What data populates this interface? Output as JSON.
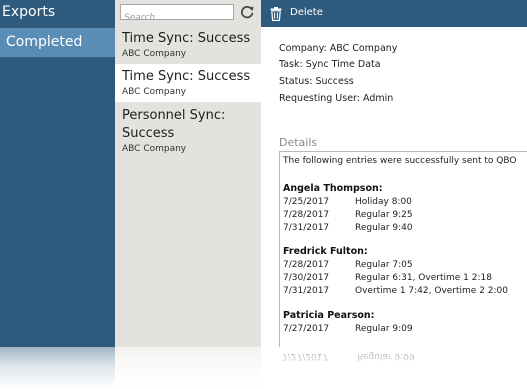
{
  "nav": {
    "title": "Exports",
    "items": [
      {
        "label": "Completed"
      }
    ]
  },
  "list": {
    "search_placeholder": "Search ...",
    "items": [
      {
        "title": "Time Sync: Success",
        "subtitle": "ABC Company"
      },
      {
        "title": "Time Sync: Success",
        "subtitle": "ABC Company"
      },
      {
        "title": "Personnel Sync: Success",
        "subtitle": "ABC Company"
      }
    ]
  },
  "toolbar": {
    "delete_label": "Delete"
  },
  "detail": {
    "company": "Company: ABC Company",
    "task": "Task: Sync Time Data",
    "status": "Status: Success",
    "user": "Requesting User: Admin",
    "details_label": "Details",
    "intro": "The following entries were successfully sent to QBO",
    "employees": [
      {
        "name": "Angela Thompson:",
        "entries": [
          {
            "date": "7/25/2017",
            "desc": "Holiday 8:00"
          },
          {
            "date": "7/28/2017",
            "desc": "Regular 9:25"
          },
          {
            "date": "7/31/2017",
            "desc": "Regular 9:40"
          }
        ]
      },
      {
        "name": "Fredrick Fulton:",
        "entries": [
          {
            "date": "7/28/2017",
            "desc": "Regular 7:05"
          },
          {
            "date": "7/30/2017",
            "desc": "Regular 6:31, Overtime 1 2:18"
          },
          {
            "date": "7/31/2017",
            "desc": "Overtime 1 7:42, Overtime 2 2:00"
          }
        ]
      },
      {
        "name": "Patricia Pearson:",
        "entries": [
          {
            "date": "7/27/2017",
            "desc": "Regular 9:09"
          }
        ]
      }
    ]
  },
  "colors": {
    "nav_bg": "#2e5a7e",
    "nav_selected": "#5a8db6",
    "list_bg": "#e3e2df",
    "toolbar_bg": "#2e5a7e"
  },
  "icons": {
    "refresh": "refresh-icon",
    "delete": "trash-icon"
  }
}
